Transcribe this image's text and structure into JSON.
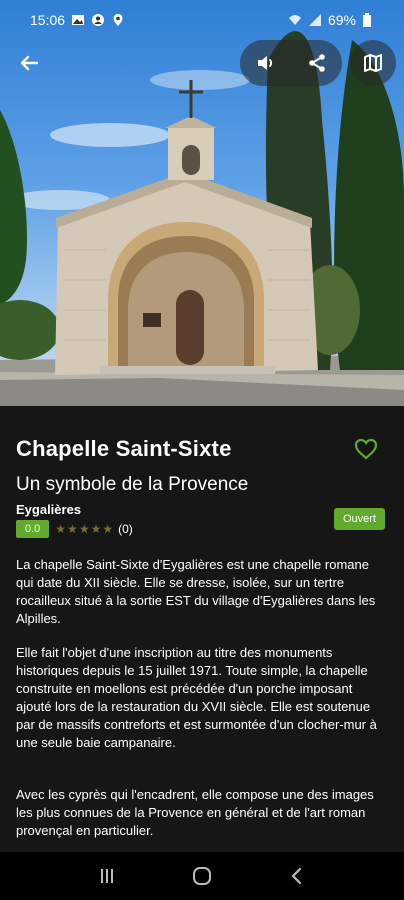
{
  "status_bar": {
    "time": "15:06",
    "battery": "69%",
    "icons_left": [
      "gallery-icon",
      "account-icon",
      "location-icon"
    ],
    "icons_right": [
      "wifi-icon",
      "signal-icon",
      "battery-icon"
    ]
  },
  "header": {
    "back": "arrow-left-icon",
    "sound": "speaker-icon",
    "share": "share-icon",
    "map": "map-icon"
  },
  "place": {
    "title": "Chapelle Saint-Sixte",
    "subtitle": "Un symbole de la Provence",
    "town": "Eygalières",
    "score": "0.0",
    "stars": "★★★★★",
    "rating_count": "(0)",
    "status": "Ouvert",
    "favorite": "heart-outline-icon"
  },
  "description": [
    "La chapelle Saint-Sixte d'Eygalières est une chapelle romane qui date du XII siècle. Elle se dresse, isolée, sur un tertre rocailleux situé à la sortie EST du village d'Eygalières dans les Alpilles.",
    "Elle fait l'objet d'une inscription au titre des monuments historiques depuis le 15 juillet 1971. Toute simple, la chapelle construite en moellons est précédée d'un porche imposant ajouté lors de la restauration du XVII siècle. Elle est soutenue par de massifs contreforts et est surmontée d'un clocher-mur à une seule baie campanaire.",
    "Avec les cyprès qui l'encadrent, elle compose une des images les plus connues de la Provence en général et de l'art roman provençal en particulier."
  ],
  "colors": {
    "accent": "#62a92d",
    "background": "#161616"
  },
  "nav": {
    "recents": "recents-icon",
    "home": "home-icon",
    "back": "back-icon"
  }
}
